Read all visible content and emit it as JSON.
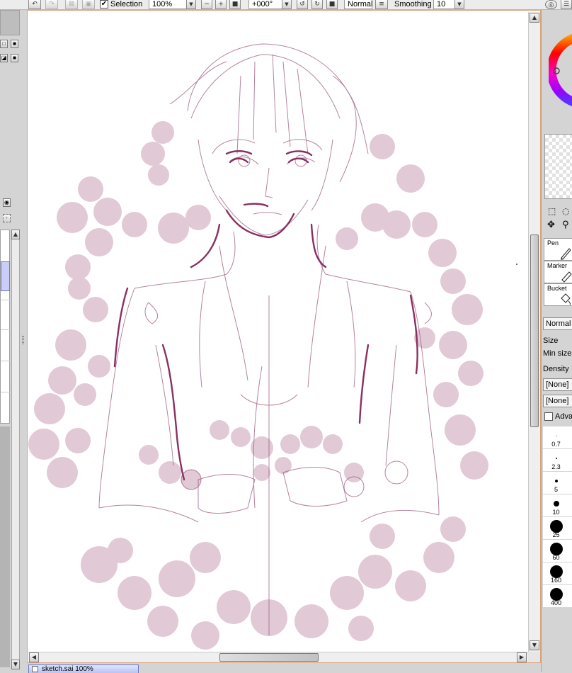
{
  "toolbar": {
    "selection_label": "Selection",
    "selection_checked": true,
    "zoom": "100%",
    "rotation": "+000°",
    "blend_mode": "Normal",
    "smoothing_label": "Smoothing",
    "smoothing_value": "10",
    "check_glyph": "✔",
    "dropdown_glyph": "▼",
    "minus_glyph": "−",
    "plus_glyph": "+"
  },
  "right_panel": {
    "tools": [
      {
        "label": "Pen",
        "icon": "pen-icon"
      },
      {
        "label": "Marker",
        "icon": "marker-icon"
      },
      {
        "label": "Bucket",
        "icon": "bucket-icon"
      }
    ],
    "mode": "Normal",
    "size_label": "Size",
    "min_size_label": "Min size",
    "density_label": "Density",
    "texture_1": "[None]",
    "texture_2": "[None]",
    "advanced_label": "Adva",
    "brush_sizes": [
      {
        "label": "0.7",
        "diameter": 1
      },
      {
        "label": "2.3",
        "diameter": 2
      },
      {
        "label": "5",
        "diameter": 4
      },
      {
        "label": "10",
        "diameter": 8
      },
      {
        "label": "25",
        "diameter": 18
      },
      {
        "label": "60",
        "diameter": 18
      },
      {
        "label": "160",
        "diameter": 18
      },
      {
        "label": "400",
        "diameter": 18
      }
    ]
  },
  "document_tab": {
    "title": "sketch.sai  100%"
  },
  "colors": {
    "sketch_line": "#9c5a80",
    "dark_line": "#8a2f62",
    "blob_fill": "#dcc0d0",
    "canvas_border": "#d7a17a",
    "tab_selected": "#b9c4f2"
  }
}
